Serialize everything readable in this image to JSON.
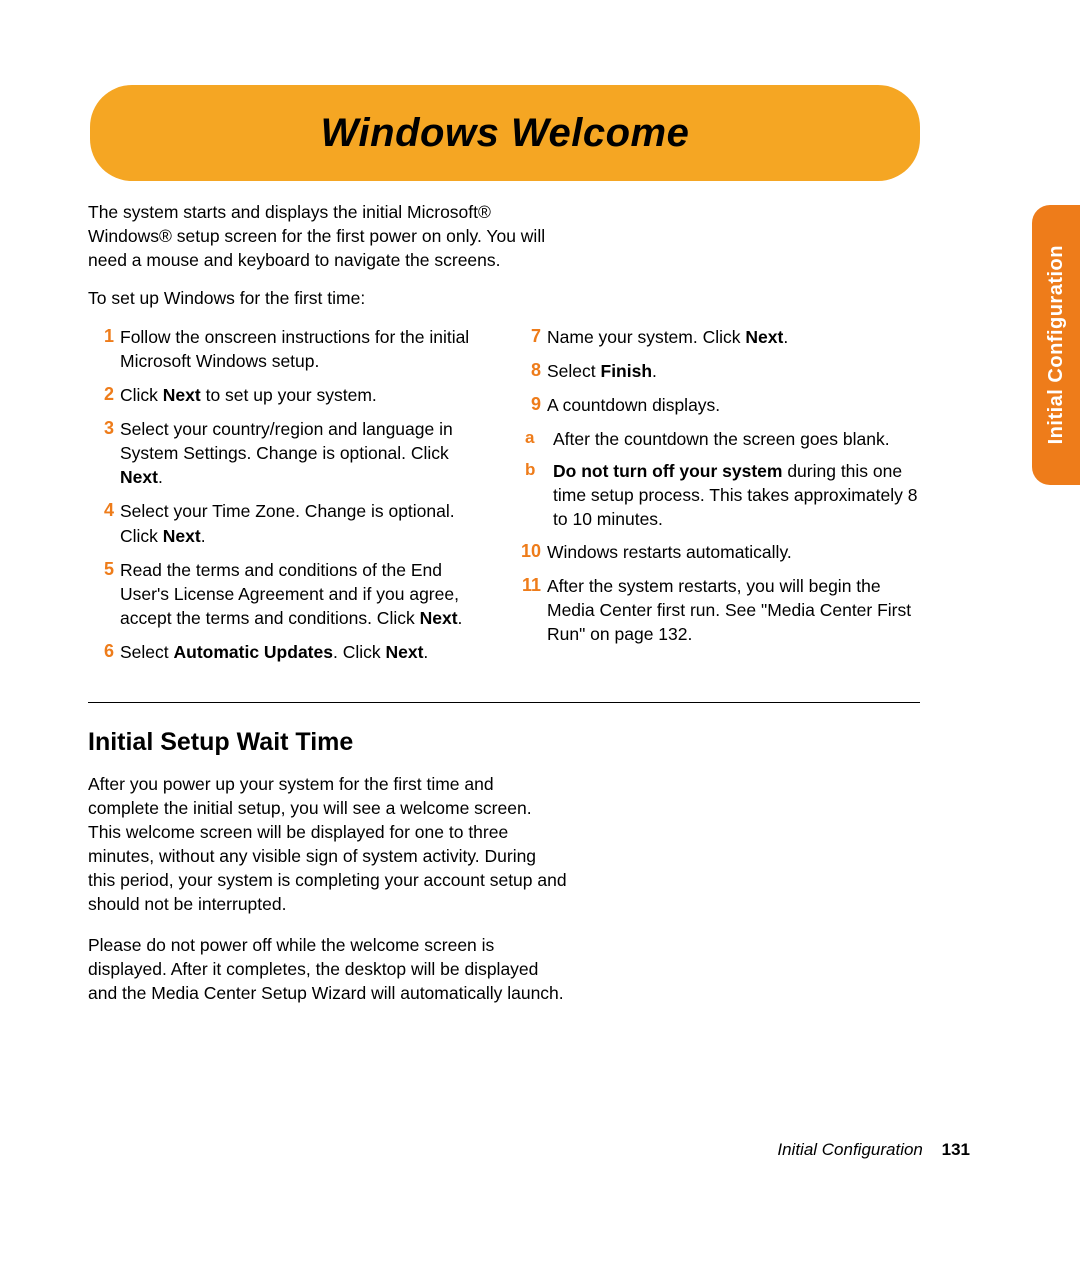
{
  "side_tab": "Initial Configuration",
  "banner_title": "Windows Welcome",
  "intro": "The system starts and displays the initial Microsoft® Windows® setup screen for the first power on only. You will need a mouse and keyboard to navigate the screens.",
  "intro2": "To set up Windows for the first time:",
  "left_steps": [
    {
      "n": "1",
      "html": "Follow the onscreen instructions for the initial Microsoft Windows setup."
    },
    {
      "n": "2",
      "html": "Click <b>Next</b> to set up your system."
    },
    {
      "n": "3",
      "html": "Select your country/region and language in System Settings. Change is optional. Click <b>Next</b>."
    },
    {
      "n": "4",
      "html": "Select your Time Zone. Change is optional. Click <b>Next</b>."
    },
    {
      "n": "5",
      "html": "Read the terms and conditions of the End User's License Agreement and if you agree, accept the terms and conditions. Click <b>Next</b>."
    },
    {
      "n": "6",
      "html": "Select <b>Automatic Updates</b>. Click <b>Next</b>."
    }
  ],
  "right_steps": [
    {
      "n": "7",
      "html": "Name your system. Click <b>Next</b>."
    },
    {
      "n": "8",
      "html": "Select <b>Finish</b>."
    },
    {
      "n": "9",
      "html": "A countdown displays.",
      "subs": [
        {
          "n": "a",
          "html": "After the countdown the screen goes blank."
        },
        {
          "n": "b",
          "html": "<b>Do not turn off your system</b> during this one time setup process. This takes approximately 8 to 10 minutes."
        }
      ]
    },
    {
      "n": "10",
      "html": "Windows restarts automatically."
    },
    {
      "n": "11",
      "html": "After the system restarts, you will begin the Media Center first run. See \"Media Center First Run\" on page 132."
    }
  ],
  "wait": {
    "heading": "Initial Setup Wait Time",
    "p1": "After you power up your system for the first time and complete the initial setup, you will see a welcome screen. This welcome screen will be displayed for one to three minutes, without any visible sign of system activity. During this period, your system is completing your account setup and should not be interrupted.",
    "p2": "Please do not power off while the welcome screen is displayed. After it completes, the desktop will be displayed and the Media Center Setup Wizard will automatically launch."
  },
  "footer": {
    "section": "Initial Configuration",
    "page": "131"
  }
}
